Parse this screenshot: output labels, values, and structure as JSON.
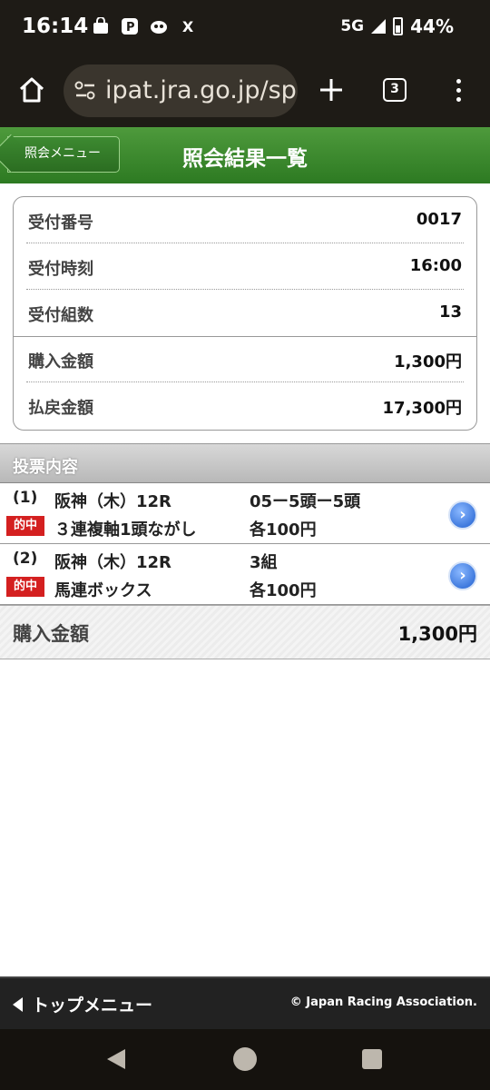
{
  "status": {
    "time": "16:14",
    "network": "5G",
    "battery": "44%",
    "notif_x": "X",
    "notif_p": "P"
  },
  "browser": {
    "url": "ipat.jra.go.jp/sp",
    "tab_count": "3"
  },
  "header": {
    "back_label": "照会メニュー",
    "title": "照会結果一覧"
  },
  "summary": {
    "rows": [
      {
        "label": "受付番号",
        "value": "0017"
      },
      {
        "label": "受付時刻",
        "value": "16:00"
      },
      {
        "label": "受付組数",
        "value": "13"
      },
      {
        "label": "購入金額",
        "value": "1,300円"
      },
      {
        "label": "払戻金額",
        "value": "17,300円"
      }
    ]
  },
  "section": {
    "title": "投票内容"
  },
  "bets": [
    {
      "num": "(1)",
      "race": "阪神（木）12R",
      "detail": "05ー5頭ー5頭",
      "hit": "的中",
      "type": "３連複軸1頭ながし",
      "amount": "各100円",
      "arrow": "›"
    },
    {
      "num": "(2)",
      "race": "阪神（木）12R",
      "detail": "3組",
      "hit": "的中",
      "type": "馬連ボックス",
      "amount": "各100円",
      "arrow": "›"
    }
  ],
  "total": {
    "label": "購入金額",
    "value": "1,300円"
  },
  "footer": {
    "top_menu": "トップメニュー",
    "copyright": "© Japan Racing Association."
  }
}
